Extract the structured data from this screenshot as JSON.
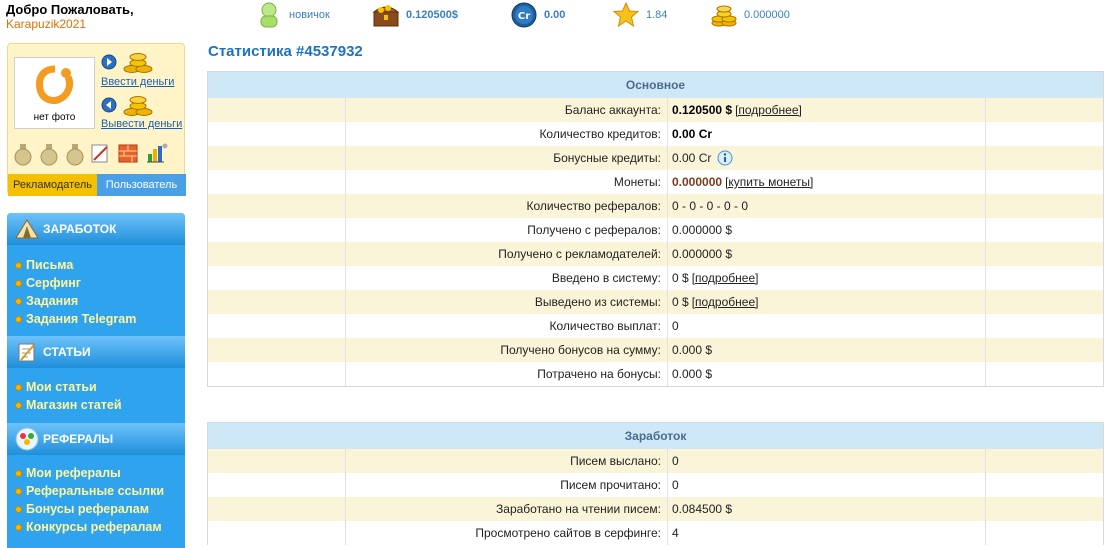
{
  "header": {
    "welcome": "Добро Пожаловать,",
    "username": "Karapuzik2021",
    "status": "новичок",
    "balance": "0.120500$",
    "credits": "0.00",
    "rating": "1.84",
    "coins": "0.000000"
  },
  "profile": {
    "no_photo": "нет фото",
    "deposit_link": "Ввести деньги",
    "withdraw_link": "Вывести деньги",
    "tab_advertiser": "Рекламодатель",
    "tab_user": "Пользователь"
  },
  "menu": {
    "sections": [
      {
        "title": "ЗАРАБОТОК",
        "icon": "tent-icon",
        "items": [
          "Письма",
          "Серфинг",
          "Задания",
          "Задания Telegram"
        ]
      },
      {
        "title": "СТАТЬИ",
        "icon": "notepad-icon",
        "items": [
          "Мои статьи",
          "Магазин статей"
        ]
      },
      {
        "title": "РЕФЕРАЛЫ",
        "icon": "people-icon",
        "items": [
          "Мои рефералы",
          "Реферальные ссылки",
          "Бонусы рефералам",
          "Конкурсы рефералам"
        ]
      }
    ]
  },
  "page": {
    "title": "Статистика #4537932"
  },
  "main_table": {
    "header": "Основное",
    "rows": [
      {
        "label": "Баланс аккаунта:",
        "value": "0.120500 $",
        "link": "[подробнее]",
        "style": "strong"
      },
      {
        "label": "Количество кредитов:",
        "value": "0.00 Cr",
        "style": "strong"
      },
      {
        "label": "Бонусные кредиты:",
        "value": "0.00 Cr",
        "info": true
      },
      {
        "label": "Монеты:",
        "value": "0.000000",
        "link": "[купить монеты]",
        "style": "coin"
      },
      {
        "label": "Количество рефералов:",
        "value": "0 - 0 - 0 - 0 - 0"
      },
      {
        "label": "Получено с рефералов:",
        "value": "0.000000 $"
      },
      {
        "label": "Получено с рекламодателей:",
        "value": "0.000000 $"
      },
      {
        "label": "Введено в систему:",
        "value": "0 $",
        "link": "[подробнее]"
      },
      {
        "label": "Выведено из системы:",
        "value": "0 $",
        "link": "[подробнее]"
      },
      {
        "label": "Количество выплат:",
        "value": "0"
      },
      {
        "label": "Получено бонусов на сумму:",
        "value": "0.000 $"
      },
      {
        "label": "Потрачено на бонусы:",
        "value": "0.000 $"
      }
    ]
  },
  "earn_table": {
    "header": "Заработок",
    "rows": [
      {
        "label": "Писем выслано:",
        "value": "0"
      },
      {
        "label": "Писем прочитано:",
        "value": "0"
      },
      {
        "label": "Заработано на чтении писем:",
        "value": "0.084500 $"
      },
      {
        "label": "Просмотрено сайтов в серфинге:",
        "value": "4"
      }
    ]
  }
}
